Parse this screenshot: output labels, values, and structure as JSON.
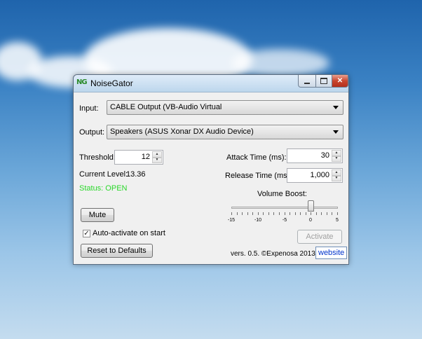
{
  "window": {
    "title": "NoiseGator",
    "icon": "ng-logo-icon",
    "icon_text": "NG"
  },
  "input": {
    "label": "Input:",
    "value": "CABLE Output (VB-Audio Virtual"
  },
  "output": {
    "label": "Output:",
    "value": "Speakers (ASUS Xonar DX Audio Device)"
  },
  "threshold": {
    "label": "Threshold:",
    "value": "12"
  },
  "current_level": {
    "label": "Current Level:",
    "value": "13.36"
  },
  "status": {
    "text": "Status: OPEN",
    "color": "#2bd82b"
  },
  "attack_time": {
    "label": "Attack Time (ms):",
    "value": "30"
  },
  "release_time": {
    "label": "Release Time (ms):",
    "value": "1,000"
  },
  "volume_boost": {
    "label": "Volume Boost:",
    "min": -15,
    "max": 5,
    "value": 0,
    "ticks": [
      -15,
      -10,
      -5,
      0,
      5
    ]
  },
  "buttons": {
    "mute": "Mute",
    "activate": "Activate",
    "reset": "Reset to Defaults",
    "website": "website"
  },
  "auto_activate": {
    "label": "Auto-activate on start",
    "checked": true
  },
  "version_text": "vers. 0.5. ©Expenosa 2013."
}
